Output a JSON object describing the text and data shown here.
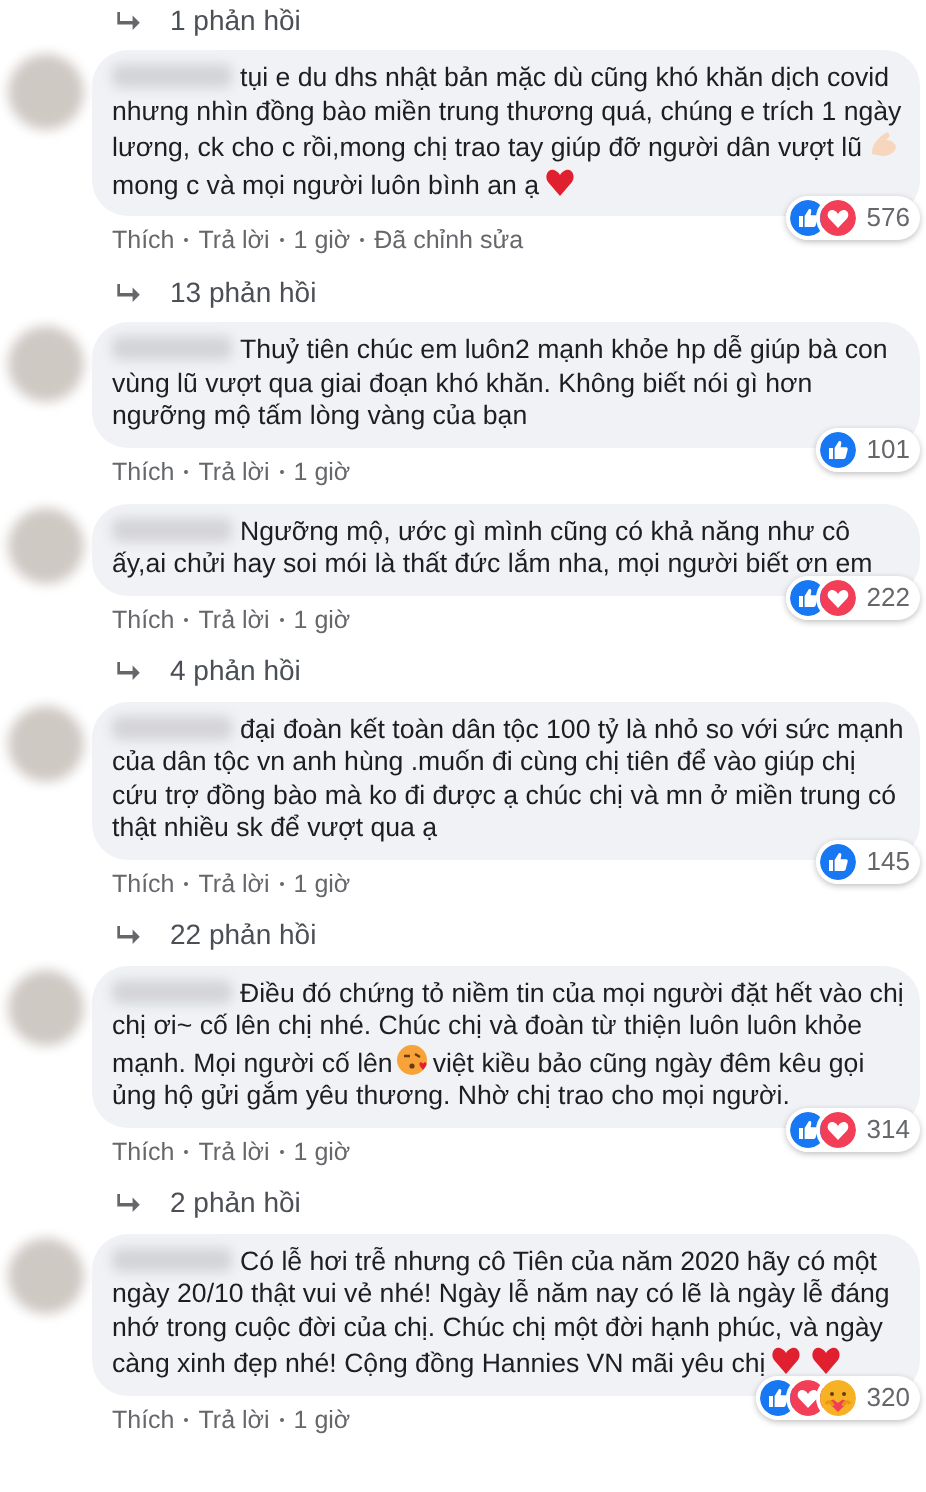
{
  "feed": [
    {
      "kind": "replies",
      "label": "1 phản hồi"
    },
    {
      "kind": "comment",
      "body": [
        {
          "kind": "text",
          "text": "tụi e du dhs nhật bản mặc dù cũng khó khăn dịch covid nhưng nhìn đồng bào miền trung thương quá, chúng e trích 1 ngày lương, ck cho c rồi,mong chị trao tay giúp đỡ người dân vượt lũ"
        },
        {
          "kind": "arm"
        },
        {
          "kind": "text",
          "text": "mong c và mọi người luôn bình an ạ"
        },
        {
          "kind": "heart"
        }
      ],
      "actions": [
        "Thích",
        "Trả lời",
        "1 giờ",
        "Đã chỉnh sửa"
      ],
      "reactions": [
        {
          "kind": "like"
        },
        {
          "kind": "love"
        }
      ],
      "count": "576"
    },
    {
      "kind": "replies",
      "label": "13 phản hồi"
    },
    {
      "kind": "comment",
      "body": [
        {
          "kind": "text",
          "text": "Thuỷ tiên chúc em luôn2 mạnh khỏe hp dễ giúp bà con vùng lũ vượt qua giai đoạn khó khăn. Không biết nói gì hơn ngưỡng mộ tấm lòng vàng của bạn"
        }
      ],
      "actions": [
        "Thích",
        "Trả lời",
        "1 giờ"
      ],
      "reactions": [
        {
          "kind": "like"
        }
      ],
      "count": "101"
    },
    {
      "kind": "comment",
      "body": [
        {
          "kind": "text",
          "text": "Ngưỡng mộ, ước gì mình cũng có khả năng như cô ấy,ai chửi hay soi mói là thất đức lắm nha, mọi người biết ơn em"
        }
      ],
      "actions": [
        "Thích",
        "Trả lời",
        "1 giờ"
      ],
      "reactions": [
        {
          "kind": "like"
        },
        {
          "kind": "love"
        }
      ],
      "count": "222"
    },
    {
      "kind": "replies",
      "label": "4 phản hồi"
    },
    {
      "kind": "comment",
      "body": [
        {
          "kind": "text",
          "text": "đại đoàn kết toàn dân tộc 100 tỷ là nhỏ so với sức mạnh của dân tộc vn anh hùng .muốn đi cùng chị tiên để vào giúp chị cứu trợ đồng bào mà ko đi được ạ chúc chị và mn ở miền trung có thật nhiều sk để vượt qua ạ"
        }
      ],
      "actions": [
        "Thích",
        "Trả lời",
        "1 giờ"
      ],
      "reactions": [
        {
          "kind": "like"
        }
      ],
      "count": "145"
    },
    {
      "kind": "replies",
      "label": "22 phản hồi"
    },
    {
      "kind": "comment",
      "body": [
        {
          "kind": "text",
          "text": "Điều đó chứng tỏ niềm tin của mọi người đặt hết vào chị chị ơi~ cố lên chị nhé. Chúc chị và đoàn từ thiện luôn luôn khỏe mạnh. Mọi người cố lên"
        },
        {
          "kind": "kiss"
        },
        {
          "kind": "text",
          "text": "việt kiều bảo cũng ngày đêm kêu gọi ủng hộ gửi gắm yêu thương. Nhờ chị trao cho mọi người."
        }
      ],
      "actions": [
        "Thích",
        "Trả lời",
        "1 giờ"
      ],
      "reactions": [
        {
          "kind": "like"
        },
        {
          "kind": "love"
        }
      ],
      "count": "314"
    },
    {
      "kind": "replies",
      "label": "2 phản hồi"
    },
    {
      "kind": "comment",
      "body": [
        {
          "kind": "text",
          "text": "Có lễ hơi trễ nhưng cô Tiên của năm 2020 hãy có một ngày 20/10 thật vui vẻ nhé! Ngày lễ năm nay có lẽ là ngày lễ đáng nhớ trong cuộc đời của chị. Chúc chị một đời hạnh phúc, và ngày càng xinh đẹp nhé! Cộng đồng Hannies VN mãi yêu chị"
        },
        {
          "kind": "heart"
        },
        {
          "kind": "heart"
        }
      ],
      "actions": [
        "Thích",
        "Trả lời",
        "1 giờ"
      ],
      "reactions": [
        {
          "kind": "like"
        },
        {
          "kind": "love"
        },
        {
          "kind": "care"
        }
      ],
      "count": "320"
    }
  ]
}
